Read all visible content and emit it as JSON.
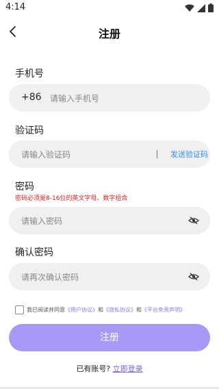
{
  "status_bar": {
    "time": "4:14"
  },
  "nav": {
    "title": "注册"
  },
  "phone": {
    "label": "手机号",
    "prefix": "+86",
    "placeholder": "请输入手机号"
  },
  "code": {
    "label": "验证码",
    "placeholder": "请输入验证码",
    "send_label": "发送验证码"
  },
  "password": {
    "label": "密码",
    "hint": "密码必须是8-16位的英文字母、数字组合",
    "placeholder": "请输入密码"
  },
  "confirm": {
    "label": "确认密码",
    "placeholder": "请再次确认密码"
  },
  "agreement": {
    "prefix": "我已阅读并同意",
    "user_agreement": "《用户协议》",
    "and1": "和",
    "privacy": "《隐私协议》",
    "and2": "和",
    "disclaimer": "《平台免责声明》"
  },
  "submit_label": "注册",
  "login": {
    "prompt": "已有账号?",
    "link": "立即登录"
  },
  "colors": {
    "accent": "#a799f5",
    "link": "#3b8cf0",
    "hint": "#e02020",
    "field_bg": "#f0f0f0"
  },
  "icons": {
    "back": "chevron-left-icon",
    "eye": "eye-off-icon",
    "wifi": "wifi-icon",
    "signal": "signal-icon",
    "battery": "battery-icon"
  }
}
